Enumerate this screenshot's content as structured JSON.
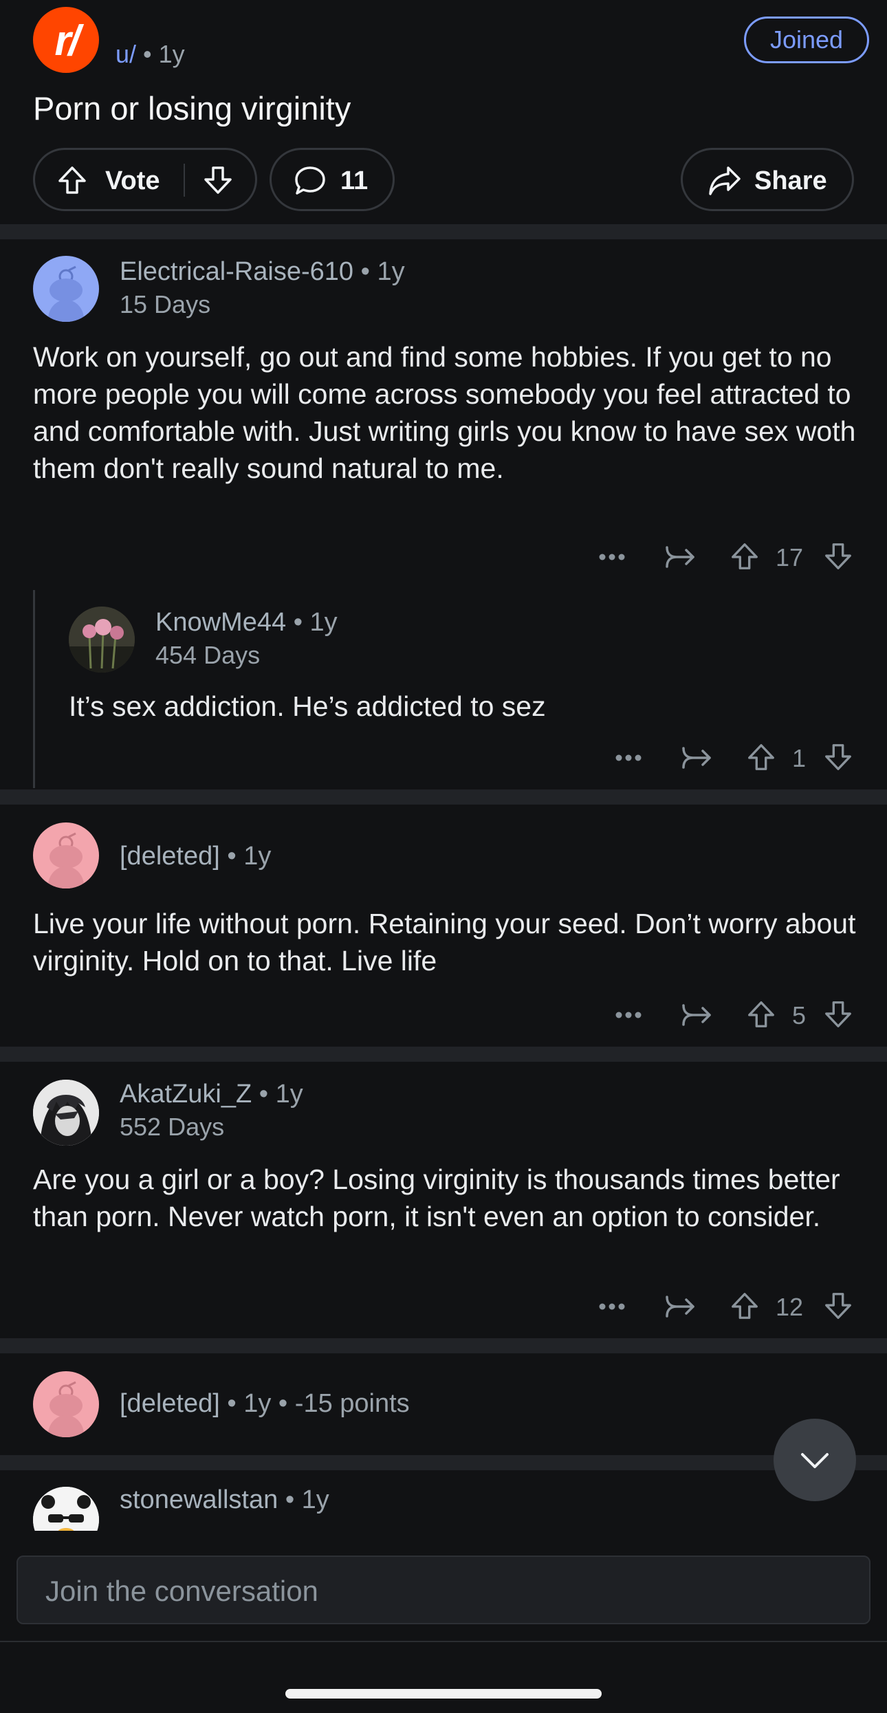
{
  "post": {
    "subreddit_logo_text": "r/",
    "author_prefix": "u/",
    "age": "• 1y",
    "joined_label": "Joined",
    "title": "Porn or losing virginity",
    "vote_label": "Vote",
    "comment_count": "11",
    "share_label": "Share"
  },
  "comments": [
    {
      "username": "Electrical-Raise-610",
      "age": "• 1y",
      "flair": "15 Days",
      "body": "Work on yourself, go out and find some hobbies. If you get to no more people you will come across somebody you feel attracted to and comfortable with. Just writing girls you know to have sex woth them don't really sound natural to me.",
      "score": "17",
      "avatar_color": "#8fa8f5"
    },
    {
      "username": "KnowMe44",
      "age": "• 1y",
      "flair": "454 Days",
      "body": "It’s sex addiction. He’s addicted to sez",
      "score": "1"
    },
    {
      "username": "[deleted]",
      "age": "• 1y",
      "body": "Live your life without porn. Retaining your seed. Don’t worry about virginity. Hold on to that. Live life",
      "score": "5",
      "avatar_color": "#f3a5ad"
    },
    {
      "username": "AkatZuki_Z",
      "age": "• 1y",
      "flair": "552 Days",
      "body": "Are you a girl or a boy? Losing virginity is thousands times better than porn. Never watch porn, it isn't even an option to consider.",
      "score": "12"
    },
    {
      "username": "[deleted]",
      "age": "• 1y",
      "points": "• -15 points",
      "avatar_color": "#f3a5ad"
    },
    {
      "username": "stonewallstan",
      "age": "• 1y"
    }
  ],
  "composer": {
    "placeholder": "Join the conversation"
  },
  "colors": {
    "accent": "#7c9cff",
    "brand": "#ff4500",
    "background": "#111214"
  }
}
